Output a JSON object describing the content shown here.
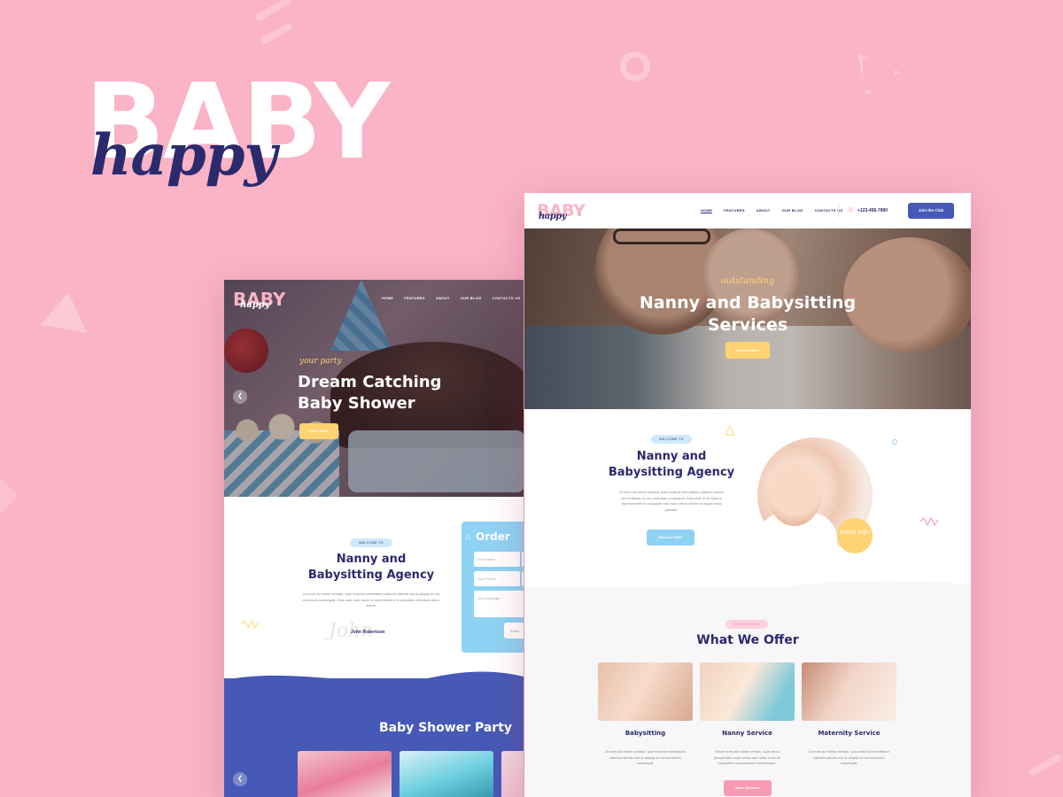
{
  "brand": {
    "big": "BABY",
    "script": "happy",
    "bg": "#fbb3c6",
    "navy": "#2b2a6d",
    "accent_blue": "#4659b6",
    "sky": "#8fd3f4",
    "yellow": "#ffd373"
  },
  "left": {
    "logo": "BABY",
    "logo_script": "happy",
    "nav": [
      "HOME",
      "FEATURES",
      "ABOUT",
      "OUR BLOG",
      "CONTACTS US"
    ],
    "hero_sub": "your party",
    "hero_title": "Dream Catching Baby Shower",
    "hero_button": "Learn More",
    "welcome_tag": "WELCOME TO",
    "about_title": "Nanny and Babysitting Agency",
    "about_text": "Ut enim ad minim veniam, quis nostrud exercitation ullamco laboris nisi ut aliquip ex ea commodo consequat. Duis aute irure dolor in reprehenderit in voluptate velit esse cillum dolore.",
    "signature": "John",
    "signature_name": "John Robertson",
    "order_title": "Order",
    "order_fields": [
      "Your Name",
      "Your Phone",
      "Your Message"
    ],
    "order_submit": "Subm",
    "party_title": "Baby Shower Party",
    "prev_icon": "chevron-left-icon"
  },
  "right": {
    "logo": "BABY",
    "logo_script": "happy",
    "nav": [
      "HOME",
      "FEATURES",
      "ABOUT",
      "OUR BLOG",
      "CONTACTS US"
    ],
    "phone": "+123-456-7890",
    "join_button": "Join the Club",
    "hero_sub": "outstanding",
    "hero_title": "Nanny and Babysitting Services",
    "hero_button": "Book a Sitter",
    "welcome_tag": "WELCOME TO",
    "about_title": "Nanny and Babysitting Agency",
    "about_text": "Ut enim ad minim veniam, quis nostrud exercitation ullamco laboris nisi ut aliquip ex ea commodo consequat. Duis aute irure dolor in reprehenderit in voluptate velit esse cillum dolore eu fugiat nulla pariatur.",
    "discover_button": "Discover More",
    "more_info": "more info",
    "services_tag": "OUR SERVICES",
    "services_title": "What We Offer",
    "services": [
      {
        "title": "Babysitting",
        "text": "Ut enim ad minim veniam, quis nostrud exercitation ullamco laboris nisi ut aliquip ex ea commodo consequat."
      },
      {
        "title": "Nanny Service",
        "text": "Minim enim ad minim veniam, quis est ut perspiciatis unde omnis iste natus error sit voluptatem accusantium doloremque."
      },
      {
        "title": "Maternity Service",
        "text": "Ut enim ad minim veniam, quis nostrud exercitation ullamco laboris nisi ut aliquip ex ea commodo consequat."
      }
    ],
    "more_services_button": "More Services"
  }
}
